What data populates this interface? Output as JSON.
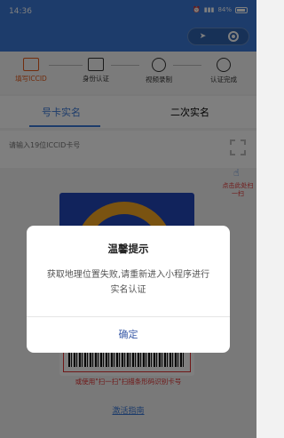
{
  "status_bar": {
    "time": "14:36",
    "battery": "84%"
  },
  "steps": [
    {
      "label": "填写ICCID",
      "active": true
    },
    {
      "label": "身份认证",
      "active": false
    },
    {
      "label": "视频录制",
      "active": false
    },
    {
      "label": "认证完成",
      "active": false
    }
  ],
  "tabs": [
    {
      "label": "号卡实名",
      "active": true
    },
    {
      "label": "二次实名",
      "active": false
    }
  ],
  "iccid_input": {
    "placeholder": "请输入19位ICCID卡号",
    "value": ""
  },
  "scan_hint": "点击此处扫一扫",
  "alt_hint": "或使用\"扫一扫\"扫描条形码识别卡号",
  "guide_link": "激活指南",
  "modal": {
    "title": "温馨提示",
    "message": "获取地理位置失败,请重新进入小程序进行实名认证",
    "confirm_label": "确定"
  },
  "colors": {
    "primary": "#3a78d6",
    "active_step": "#e25a1b",
    "alert_red": "#e03030"
  }
}
